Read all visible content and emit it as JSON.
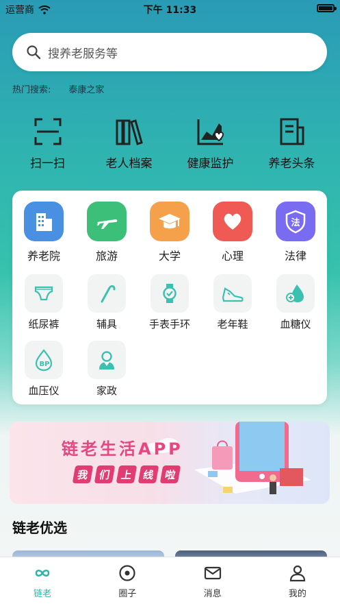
{
  "status_bar": {
    "carrier": "运营商",
    "time": "下午 11:33"
  },
  "search": {
    "placeholder": "搜养老服务等"
  },
  "hot_search": {
    "label": "热门搜索:",
    "items": [
      "泰康之家"
    ]
  },
  "quick_actions": [
    {
      "label": "扫一扫",
      "icon": "scan-icon"
    },
    {
      "label": "老人档案",
      "icon": "books-icon"
    },
    {
      "label": "健康监护",
      "icon": "health-chart-icon"
    },
    {
      "label": "养老头条",
      "icon": "news-icon"
    }
  ],
  "categories_main": [
    {
      "label": "养老院",
      "icon": "building-icon",
      "color": "#4a90e2"
    },
    {
      "label": "旅游",
      "icon": "airplane-icon",
      "color": "#3cbf78"
    },
    {
      "label": "大学",
      "icon": "graduation-cap-icon",
      "color": "#f5a04a"
    },
    {
      "label": "心理",
      "icon": "heart-icon",
      "color": "#ef5a55"
    },
    {
      "label": "法律",
      "icon": "law-shield-icon",
      "color": "#7a6cf0",
      "badge": "法"
    }
  ],
  "categories_products": [
    {
      "label": "纸尿裤",
      "icon": "diaper-icon"
    },
    {
      "label": "辅具",
      "icon": "cane-icon"
    },
    {
      "label": "手表手环",
      "icon": "watch-icon"
    },
    {
      "label": "老年鞋",
      "icon": "shoe-icon"
    },
    {
      "label": "血糖仪",
      "icon": "glucose-drop-icon"
    },
    {
      "label": "血压仪",
      "icon": "blood-pressure-icon",
      "badge": "BP"
    },
    {
      "label": "家政",
      "icon": "housekeeper-icon"
    }
  ],
  "banner": {
    "title": "链老生活APP",
    "subtitle_chars": [
      "我",
      "们",
      "上",
      "线",
      "啦"
    ]
  },
  "section": {
    "title": "链老优选"
  },
  "tab_bar": [
    {
      "label": "链老",
      "icon": "infinity-icon",
      "active": true
    },
    {
      "label": "圈子",
      "icon": "circle-dot-icon",
      "active": false
    },
    {
      "label": "消息",
      "icon": "mail-icon",
      "active": false
    },
    {
      "label": "我的",
      "icon": "user-icon",
      "active": false
    }
  ],
  "colors": {
    "accent": "#2fb2a8",
    "icon_teal": "#3cc1b0"
  }
}
